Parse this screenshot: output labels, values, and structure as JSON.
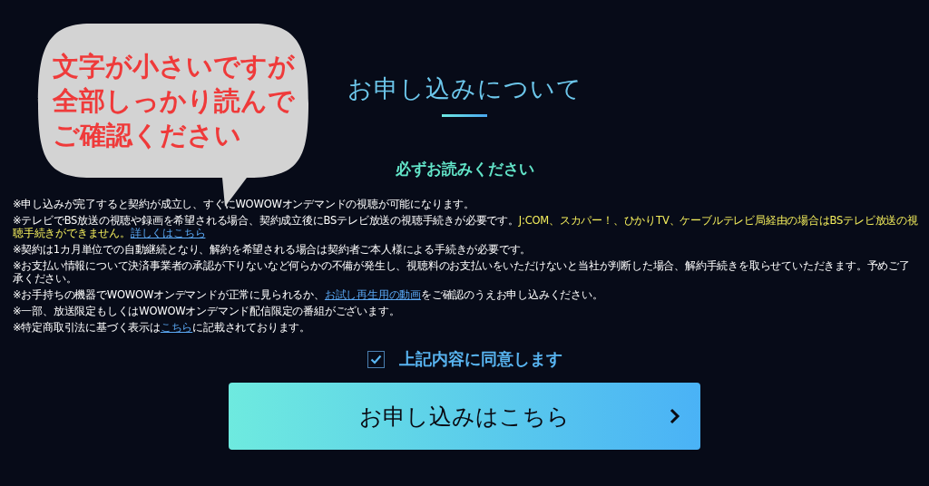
{
  "callout": {
    "lines": [
      "文字が小さいですが",
      "全部しっかり読んで",
      "ご確認ください"
    ]
  },
  "heading": "お申し込みについて",
  "subheading": "必ずお読みください",
  "notes": [
    [
      {
        "kind": "text",
        "text": "※申し込みが完了すると契約が成立し、すぐにWOWOWオンデマンドの視聴が可能になります。"
      }
    ],
    [
      {
        "kind": "text",
        "text": "※テレビでBS放送の視聴や録画を希望される場合、契約成立後にBSテレビ放送の視聴手続きが必要です。"
      },
      {
        "kind": "highlight",
        "text": "J:COM、スカパー！、ひかりTV、ケーブルテレビ局経由の場合はBSテレビ放送の視聴手続きができません。"
      },
      {
        "kind": "link",
        "text": "詳しくはこちら"
      }
    ],
    [
      {
        "kind": "text",
        "text": "※契約は1カ月単位での自動継続となり、解約を希望される場合は契約者ご本人様による手続きが必要です。"
      }
    ],
    [
      {
        "kind": "text",
        "text": "※お支払い情報について決済事業者の承認が下りないなど何らかの不備が発生し、視聴料のお支払いをいただけないと当社が判断した場合、解約手続きを取らせていただきます。予めご了承ください。"
      }
    ],
    [
      {
        "kind": "text",
        "text": "※お手持ちの機器でWOWOWオンデマンドが正常に見られるか、"
      },
      {
        "kind": "link",
        "text": "お試し再生用の動画"
      },
      {
        "kind": "text",
        "text": "をご確認のうえお申し込みください。"
      }
    ],
    [
      {
        "kind": "text",
        "text": "※一部、放送限定もしくはWOWOWオンデマンド配信限定の番組がございます。"
      }
    ],
    [
      {
        "kind": "text",
        "text": "※特定商取引法に基づく表示は"
      },
      {
        "kind": "link",
        "text": "こちら"
      },
      {
        "kind": "text",
        "text": "に記載されております。"
      }
    ]
  ],
  "agree": {
    "label": "上記内容に同意します",
    "checked": true
  },
  "apply_button": {
    "label": "お申し込みはこちら"
  }
}
